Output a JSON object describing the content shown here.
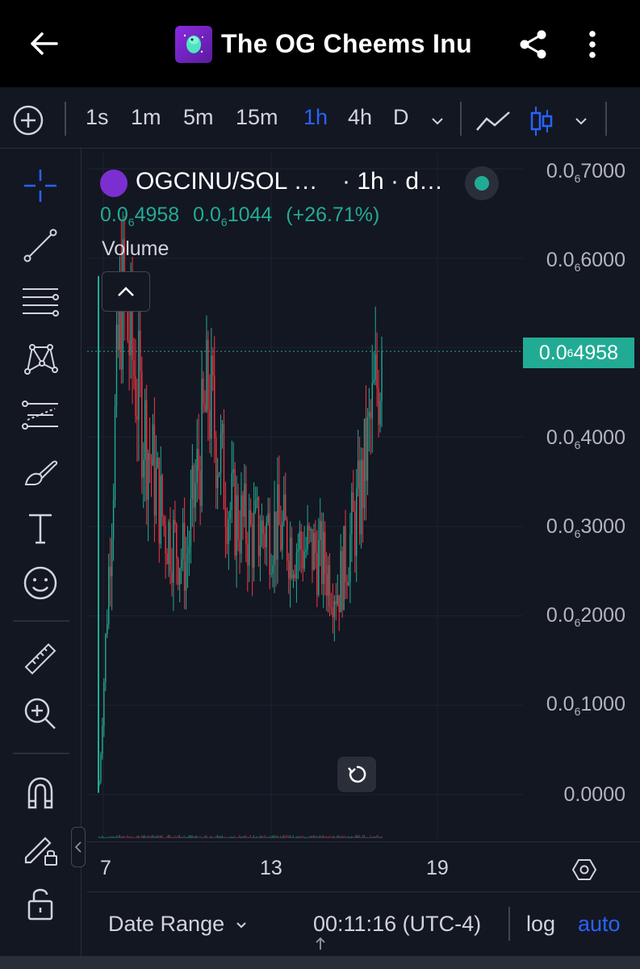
{
  "app": {
    "title": "The OG Cheems Inu"
  },
  "toolbar": {
    "intervals": [
      "1s",
      "1m",
      "5m",
      "15m",
      "1h",
      "4h",
      "D"
    ],
    "active_interval": "1h"
  },
  "legend": {
    "symbol": "OGCINU/SOL …",
    "meta": "· 1h · d…",
    "close_prefix": "0.0",
    "close_sub": "6",
    "close_tail": "4958",
    "change_prefix": "0.0",
    "change_sub": "6",
    "change_tail": "1044",
    "change_pct": "(+26.71%)",
    "volume_label": "Volume"
  },
  "price_scale": {
    "labels": [
      {
        "prefix": "0.0",
        "sub": "6",
        "tail": "7000"
      },
      {
        "prefix": "0.0",
        "sub": "6",
        "tail": "6000"
      },
      {
        "prefix": "0.0",
        "sub": "6",
        "tail": "4000"
      },
      {
        "prefix": "0.0",
        "sub": "6",
        "tail": "3000"
      },
      {
        "prefix": "0.0",
        "sub": "6",
        "tail": "2000"
      },
      {
        "prefix": "0.0",
        "sub": "6",
        "tail": "1000"
      },
      {
        "prefix": "0.0000",
        "sub": "",
        "tail": ""
      }
    ],
    "current": {
      "prefix": "0.0",
      "sub": "6",
      "tail": "4958"
    }
  },
  "time_axis": {
    "labels": [
      "7",
      "13",
      "19"
    ]
  },
  "bottom": {
    "date_range": "Date Range",
    "clock": "00:11:16 (UTC-4)",
    "log": "log",
    "auto": "auto"
  },
  "colors": {
    "up": "#22ab94",
    "down": "#f23645",
    "accent": "#2962ff",
    "background": "#131722"
  },
  "chart_data": {
    "type": "candlestick",
    "symbol": "OGCINU/SOL",
    "interval": "1h",
    "y_unit_note": "price in units of 1e-7 SOL (0.0₆X = X·1e-7... axis labels 0.0₆1000–0.0₆7000)",
    "ylim": [
      0,
      7000
    ],
    "yticks": [
      0,
      1000,
      2000,
      3000,
      4000,
      6000,
      7000
    ],
    "xticks": [
      "7",
      "13",
      "19"
    ],
    "last_close": 4958,
    "change": 1044,
    "change_pct": 26.71,
    "approx_series": [
      {
        "x": "6",
        "value": 100
      },
      {
        "x": "7",
        "value": 5600
      },
      {
        "x": "7",
        "value": 4200
      },
      {
        "x": "8",
        "value": 3000
      },
      {
        "x": "9",
        "value": 2600
      },
      {
        "x": "10",
        "value": 4500
      },
      {
        "x": "11",
        "value": 3200
      },
      {
        "x": "12",
        "value": 2900
      },
      {
        "x": "13",
        "value": 3000
      },
      {
        "x": "14",
        "value": 2800
      },
      {
        "x": "15",
        "value": 2700
      },
      {
        "x": "16",
        "value": 2300
      },
      {
        "x": "17",
        "value": 3300
      },
      {
        "x": "17",
        "value": 4958
      }
    ]
  }
}
